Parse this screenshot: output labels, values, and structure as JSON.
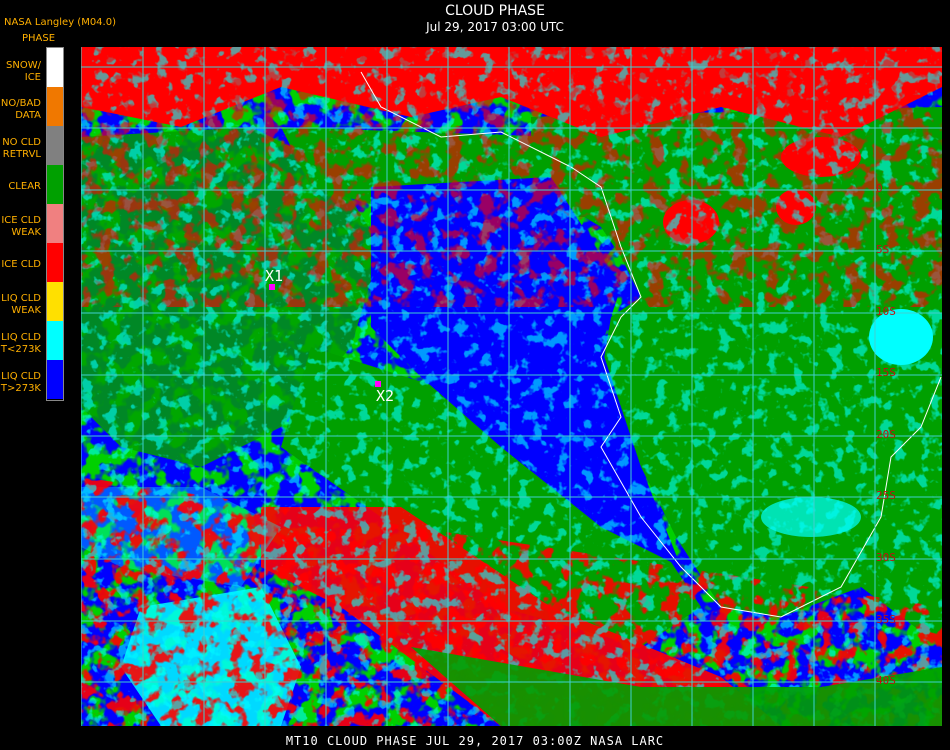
{
  "header": {
    "title": "CLOUD PHASE",
    "subtitle": "Jul 29, 2017 03:00 UTC",
    "brand": "NASA Langley (M04.0)"
  },
  "legend": {
    "title": "PHASE",
    "items": [
      {
        "label": "SNOW/\nICE",
        "color": "#ffffff"
      },
      {
        "label": "NO/BAD\nDATA",
        "color": "#f07800"
      },
      {
        "label": "NO CLD\nRETRVL",
        "color": "#808080"
      },
      {
        "label": "CLEAR",
        "color": "#00a000"
      },
      {
        "label": "ICE CLD\nWEAK",
        "color": "#f08080"
      },
      {
        "label": "ICE CLD",
        "color": "#ff0000"
      },
      {
        "label": "LIQ CLD\nWEAK",
        "color": "#ffe000"
      },
      {
        "label": "LIQ CLD\nT<273K",
        "color": "#00ffff"
      },
      {
        "label": "LIQ CLD\nT>273K",
        "color": "#0000ff"
      }
    ]
  },
  "markers": [
    {
      "label": "X1"
    },
    {
      "label": "X2"
    }
  ],
  "lat_labels": [
    "0",
    "5S",
    "10S",
    "15S",
    "20S",
    "25S",
    "30S",
    "35S",
    "40S"
  ],
  "footer": "MT10  CLOUD PHASE   JUL 29, 2017 03:00Z   NASA LARC",
  "colors": {
    "clear": "#00a000",
    "ice": "#ff0000",
    "liq_cold": "#00ffff",
    "liq_warm": "#0000ff",
    "grid": "#40d0d0",
    "coast": "#ffffff",
    "lat_label": "#c01010"
  }
}
